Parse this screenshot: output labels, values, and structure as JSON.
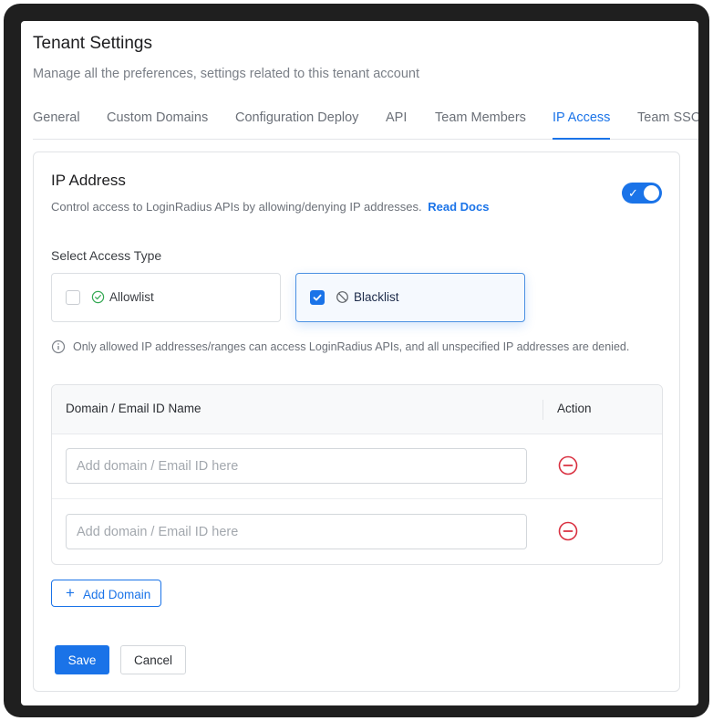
{
  "page": {
    "title": "Tenant Settings",
    "subtitle": "Manage all the preferences, settings related to this tenant account"
  },
  "tabs": [
    {
      "label": "General"
    },
    {
      "label": "Custom Domains"
    },
    {
      "label": "Configuration Deploy"
    },
    {
      "label": "API"
    },
    {
      "label": "Team Members"
    },
    {
      "label": "IP Access",
      "active": true
    },
    {
      "label": "Team SSO"
    }
  ],
  "ip_section": {
    "title": "IP Address",
    "description": "Control access to LoginRadius APIs by allowing/denying IP addresses.",
    "docs_link": "Read Docs",
    "enabled": true
  },
  "access_type": {
    "label": "Select Access Type",
    "options": [
      {
        "label": "Allowlist",
        "icon": "check-circle-icon",
        "checked": false
      },
      {
        "label": "Blacklist",
        "icon": "block-icon",
        "checked": true
      }
    ],
    "info": "Only allowed IP addresses/ranges can access LoginRadius APIs, and all unspecified IP addresses are denied."
  },
  "table": {
    "headers": {
      "name": "Domain / Email ID Name",
      "action": "Action"
    },
    "rows": [
      {
        "value": "",
        "placeholder": "Add domain / Email ID here"
      },
      {
        "value": "",
        "placeholder": "Add domain / Email ID here"
      }
    ]
  },
  "actions": {
    "add_domain": "Add Domain",
    "save": "Save",
    "cancel": "Cancel"
  },
  "colors": {
    "accent": "#1a73e8",
    "danger": "#d93040",
    "success": "#34a853"
  }
}
